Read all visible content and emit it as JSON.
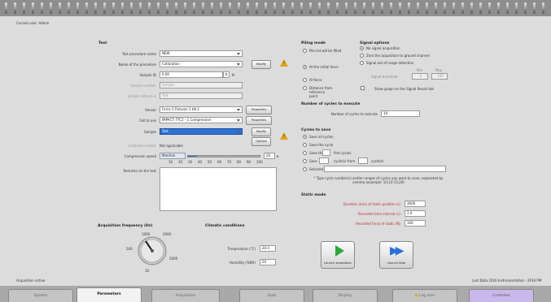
{
  "header": {
    "subtitle": "Current user: Admin"
  },
  "test_panel": {
    "title": "Test",
    "rows": [
      {
        "label": "Test procedure name",
        "value": "NEW"
      },
      {
        "label": "Name of the procedure",
        "value": "Calibration"
      },
      {
        "label": "Sample ID",
        "value": "0.00",
        "unit": "N"
      },
      {
        "label": "Sample number",
        "value": "Sample"
      },
      {
        "label": "Sample reference",
        "value": "Test"
      },
      {
        "label": "Sensor",
        "value": "Force 5 Fixtures 1 kN 2"
      },
      {
        "label": "Cell to use",
        "value": "IMPACT: FTC2 - 1 Compression"
      },
      {
        "label": "Sample",
        "value": "Test"
      },
      {
        "label": "Calibration factor",
        "value": "Not applicable"
      }
    ],
    "buttons": {
      "modify1": "Modify",
      "properties1": "Properties",
      "properties2": "Properties",
      "modify2": "Modify",
      "options": "Options"
    },
    "warning_glyph": "!",
    "compression_speed": {
      "label": "Compression speed",
      "value_label": "Mm/min",
      "value": "20",
      "level": 0.12,
      "ticks": [
        "10",
        "20",
        "30",
        "40",
        "50",
        "60",
        "70",
        "80",
        "90",
        "100"
      ]
    },
    "comments_label": "Remarks on the test"
  },
  "acq_panel": {
    "title": "Acquisition frequency (Hz)",
    "dial_labels": [
      "1000",
      "2000",
      "500",
      "10",
      "5000"
    ]
  },
  "climatic_panel": {
    "title": "Climatic conditions",
    "temp_label": "Temperature (°C)",
    "temp_value": "20.0",
    "hum_label": "Humidity (%RH)",
    "hum_value": "50"
  },
  "piling": {
    "title": "Piling mode",
    "options": [
      "Pile list will be filled",
      "At the initial force",
      "At force",
      "Distance from reference point"
    ]
  },
  "signal": {
    "title": "Signal options",
    "options": [
      "No signal acquisition",
      "Zero the acquisition to ground channel",
      "Signal out of range detection"
    ],
    "col1": "Min",
    "col2": "Max",
    "threshold_label": "Signal threshold",
    "min": "0",
    "max": "100",
    "memory_label": "Show graph on the Signal Result tab"
  },
  "cycles_count": {
    "title": "Number of cycles to execute",
    "label": "Number of cycles to execute",
    "value": "10"
  },
  "cycles_save": {
    "title": "Cycles to save",
    "options": [
      "Save all cycles",
      "Save the cycle",
      "Save the",
      "Save",
      "Selected"
    ],
    "first_cycles": "first cycles",
    "from_label": "cycle(s) from",
    "to_label": "cycle(s)",
    "note": "* Type cycle number(s) and/or ranges of cycles you want to save, separated by comma (example: 10;13-15;20)"
  },
  "static": {
    "title": "Static mode",
    "rows": [
      {
        "label": "Duration (min) of static position (s)",
        "value": "3600"
      },
      {
        "label": "Recorded time interval (s)",
        "value": "1.0"
      },
      {
        "label": "Recorded force of static (N)",
        "value": "100"
      }
    ]
  },
  "actions": {
    "start": "Launch acquisition",
    "stop": "Launch Stop"
  },
  "status": {
    "left": "Acquisition active",
    "right": "Last Data 2016 Instrumentation - 2016 PM"
  },
  "tabs": [
    "System",
    "Parameters",
    "Acquisition",
    "Data",
    "Display",
    "Log user",
    "Controller"
  ],
  "colors": {
    "accent": "#2f72d6",
    "warning": "#e3a21a",
    "start_green": "#2ea83a",
    "stop_blue": "#2b6fd8",
    "tab_controller": "#c9b8ea",
    "label_red": "#c62828"
  }
}
